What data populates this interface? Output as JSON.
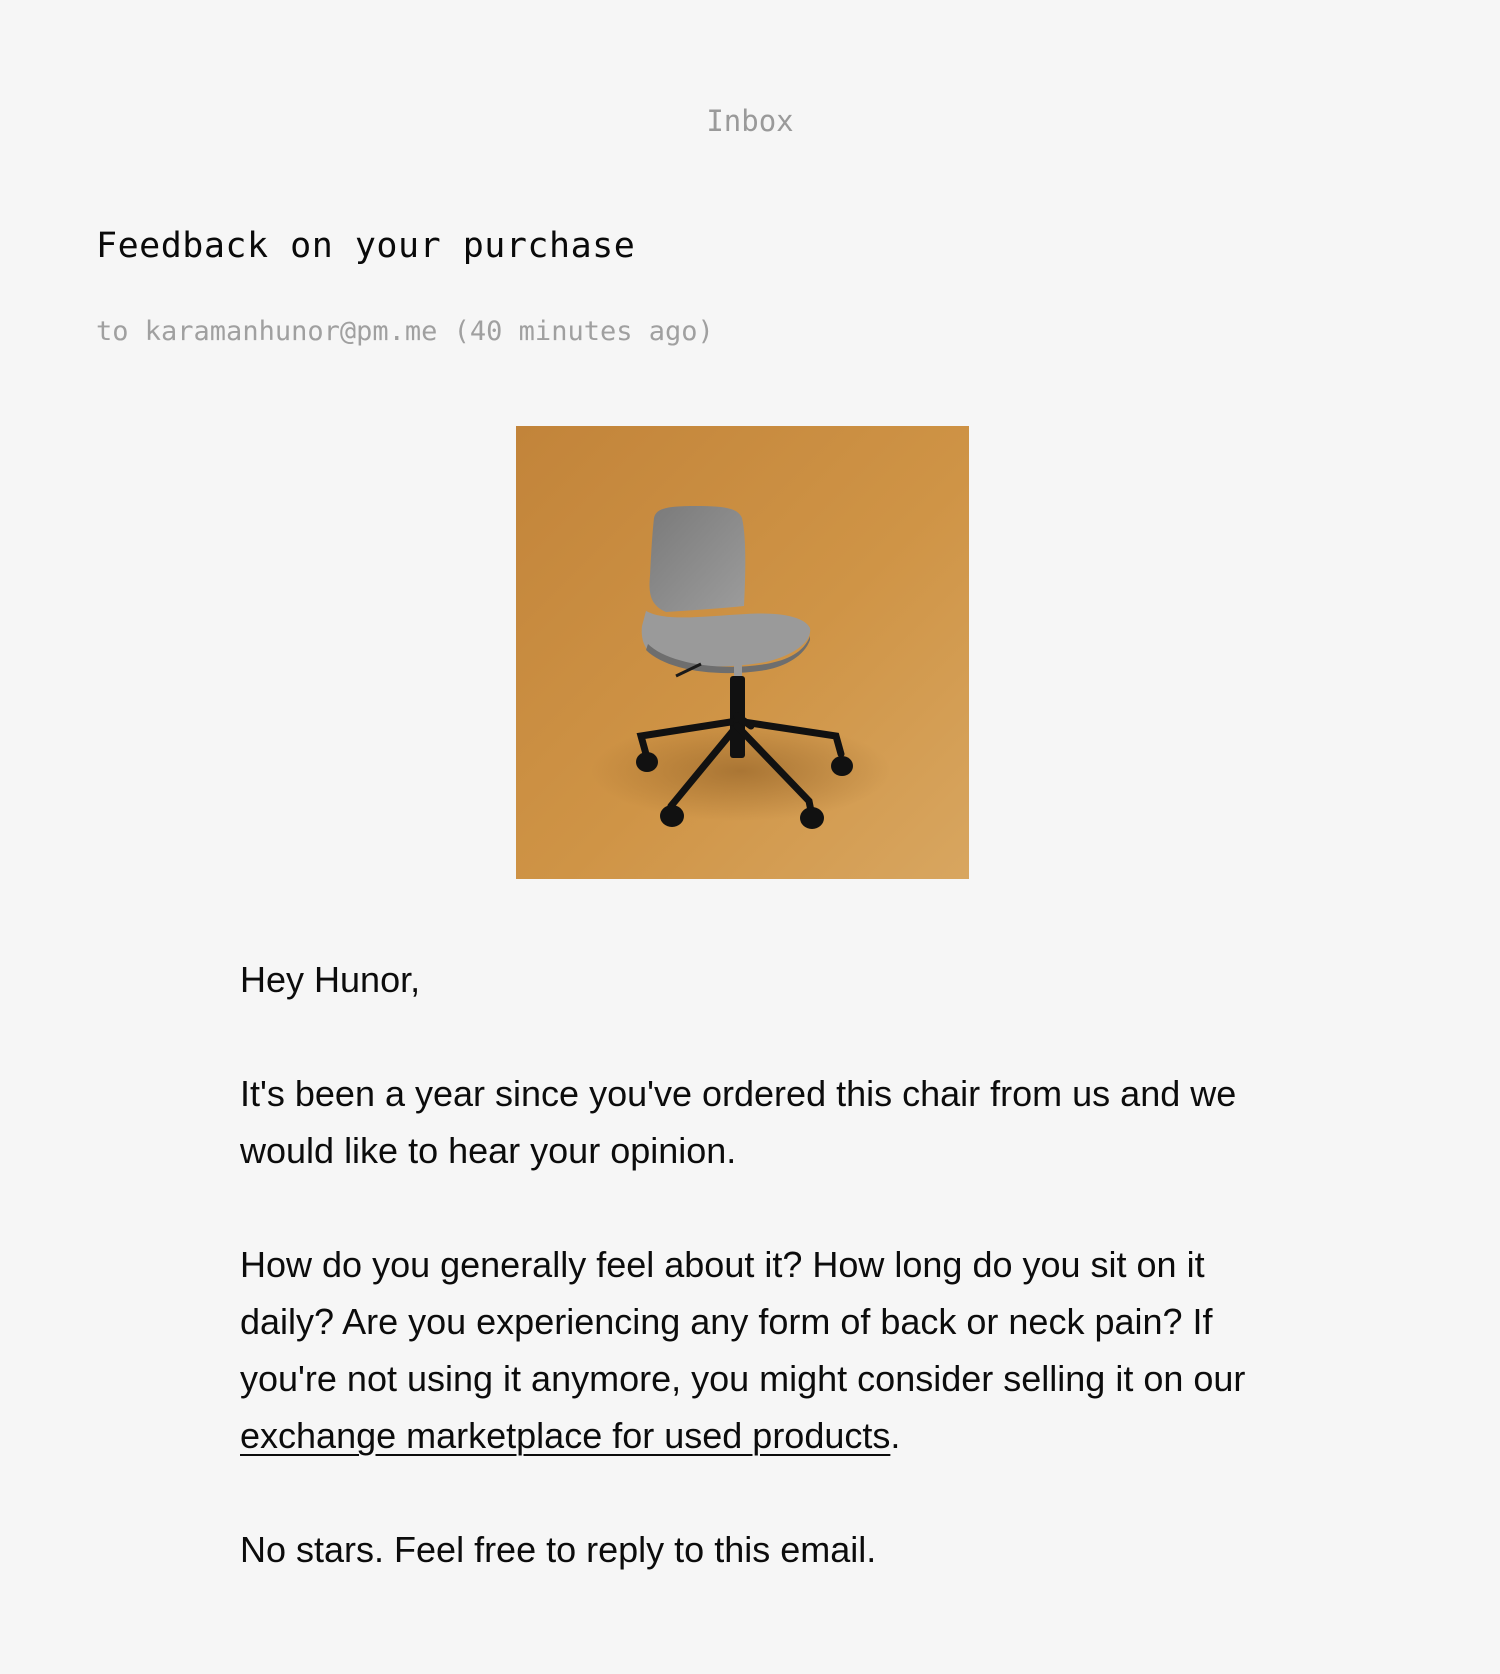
{
  "nav": {
    "inbox_label": "Inbox"
  },
  "email": {
    "subject": "Feedback on your purchase",
    "recipient_prefix": "to",
    "recipient": "karamanhunor@pm.me",
    "time_ago": "(40 minutes ago)",
    "image": {
      "subject": "grey-office-chair",
      "background_color": "#d09a4e",
      "seat_color": "#8a8a8a",
      "base_color": "#111111"
    },
    "greeting": "Hey Hunor,",
    "paragraph1": "It's been a year since you've ordered this chair from us and we would like to hear your opinion.",
    "paragraph2_text": "How do you generally feel about it? How long do you sit on it daily? Are you experiencing any form of back or neck pain? If you're not using it anymore, you might consider selling it on our ",
    "paragraph2_link": "exchange marketplace for used products",
    "paragraph2_end": ".",
    "closing": "No stars. Feel free to reply to this email."
  }
}
